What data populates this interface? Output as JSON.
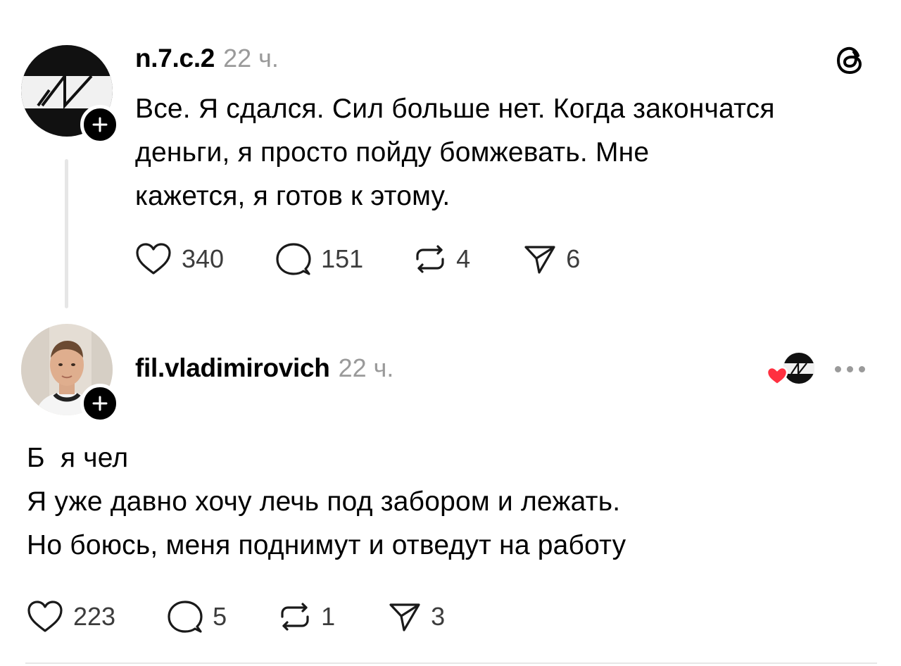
{
  "posts": [
    {
      "username": "n.7.c.2",
      "time": "22 ч.",
      "lines": [
        "Все. Я сдался. Сил больше нет. Когда закончатся",
        "деньги, я просто пойду бомжевать. Мне",
        "кажется, я готов к этому."
      ],
      "actions": {
        "likes": "340",
        "comments": "151",
        "reposts": "4",
        "shares": "6"
      }
    },
    {
      "username": "fil.vladimirovich",
      "time": "22 ч.",
      "lines": [
        "Б  я чел",
        "Я уже давно хочу лечь под забором и лежать.",
        "Но боюсь, меня поднимут и отведут на работу"
      ],
      "actions": {
        "likes": "223",
        "comments": "5",
        "reposts": "1",
        "shares": "3"
      }
    }
  ],
  "icons": {
    "app_logo": "threads-logo-icon",
    "follow": "plus-icon",
    "like": "heart-icon",
    "comment": "comment-bubble-icon",
    "repost": "repost-icon",
    "share": "send-icon",
    "more": "more-dots-icon"
  },
  "colors": {
    "text": "#000000",
    "muted": "#9a9a9a",
    "heart_red": "#ff3040",
    "divider": "#e6e6e6"
  }
}
